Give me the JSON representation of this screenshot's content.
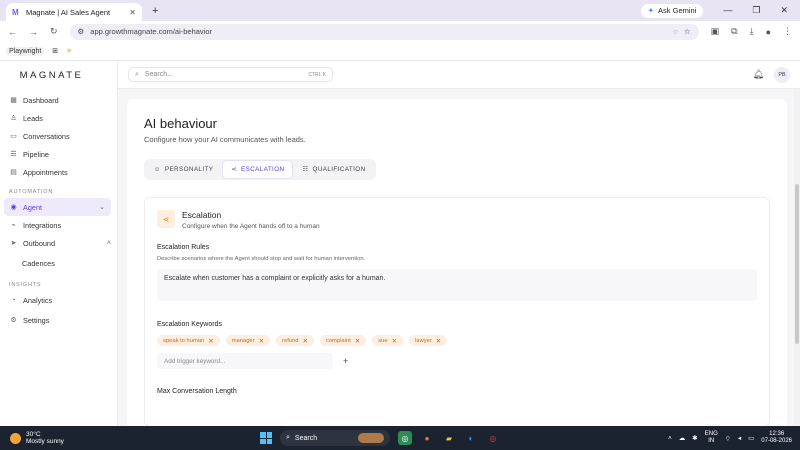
{
  "browser": {
    "tab_title": "Magnate | AI Sales Agent",
    "tab_favicon": "M",
    "url": "app.growthmagnate.com/ai-behavior",
    "gemini_label": "Ask Gemini",
    "bookmark_playwright": "Playwright"
  },
  "sidebar": {
    "logo": "MAGNATE",
    "items": [
      {
        "label": "Dashboard"
      },
      {
        "label": "Leads"
      },
      {
        "label": "Conversations"
      },
      {
        "label": "Pipeline"
      },
      {
        "label": "Appointments"
      }
    ],
    "section_automation": "AUTOMATION",
    "automation_items": [
      {
        "label": "Agent"
      },
      {
        "label": "Integrations"
      },
      {
        "label": "Outbound"
      },
      {
        "label": "Cadences"
      }
    ],
    "section_insights": "INSIGHTS",
    "insights_items": [
      {
        "label": "Analytics"
      },
      {
        "label": "Settings"
      }
    ]
  },
  "topbar": {
    "search_placeholder": "Search...",
    "search_shortcut": "CTRL K",
    "avatar_initials": "PB"
  },
  "page": {
    "title": "AI behaviour",
    "subtitle": "Configure how your AI communicates with leads.",
    "tabs": [
      {
        "label": "PERSONALITY"
      },
      {
        "label": "ESCALATION"
      },
      {
        "label": "QUALIFICATION"
      }
    ],
    "escalation": {
      "title": "Escalation",
      "subtitle": "Configure when the Agent hands off to a human",
      "rules_label": "Escalation Rules",
      "rules_help": "Describe scenarios where the Agent should stop and wait for human intervention.",
      "rules_value": "Escalate when customer has a complaint or explicitly asks for a human.",
      "keywords_label": "Escalation Keywords",
      "keywords": [
        "speak to human",
        "manager",
        "refund",
        "complaint",
        "sue",
        "lawyer"
      ],
      "keyword_placeholder": "Add trigger keyword...",
      "max_length_label": "Max Conversation Length"
    }
  },
  "taskbar": {
    "temp": "30°C",
    "weather": "Mostly sunny",
    "search_label": "Search",
    "lang1": "ENG",
    "lang2": "IN",
    "time": "12:36",
    "date": "07-08-2026"
  }
}
